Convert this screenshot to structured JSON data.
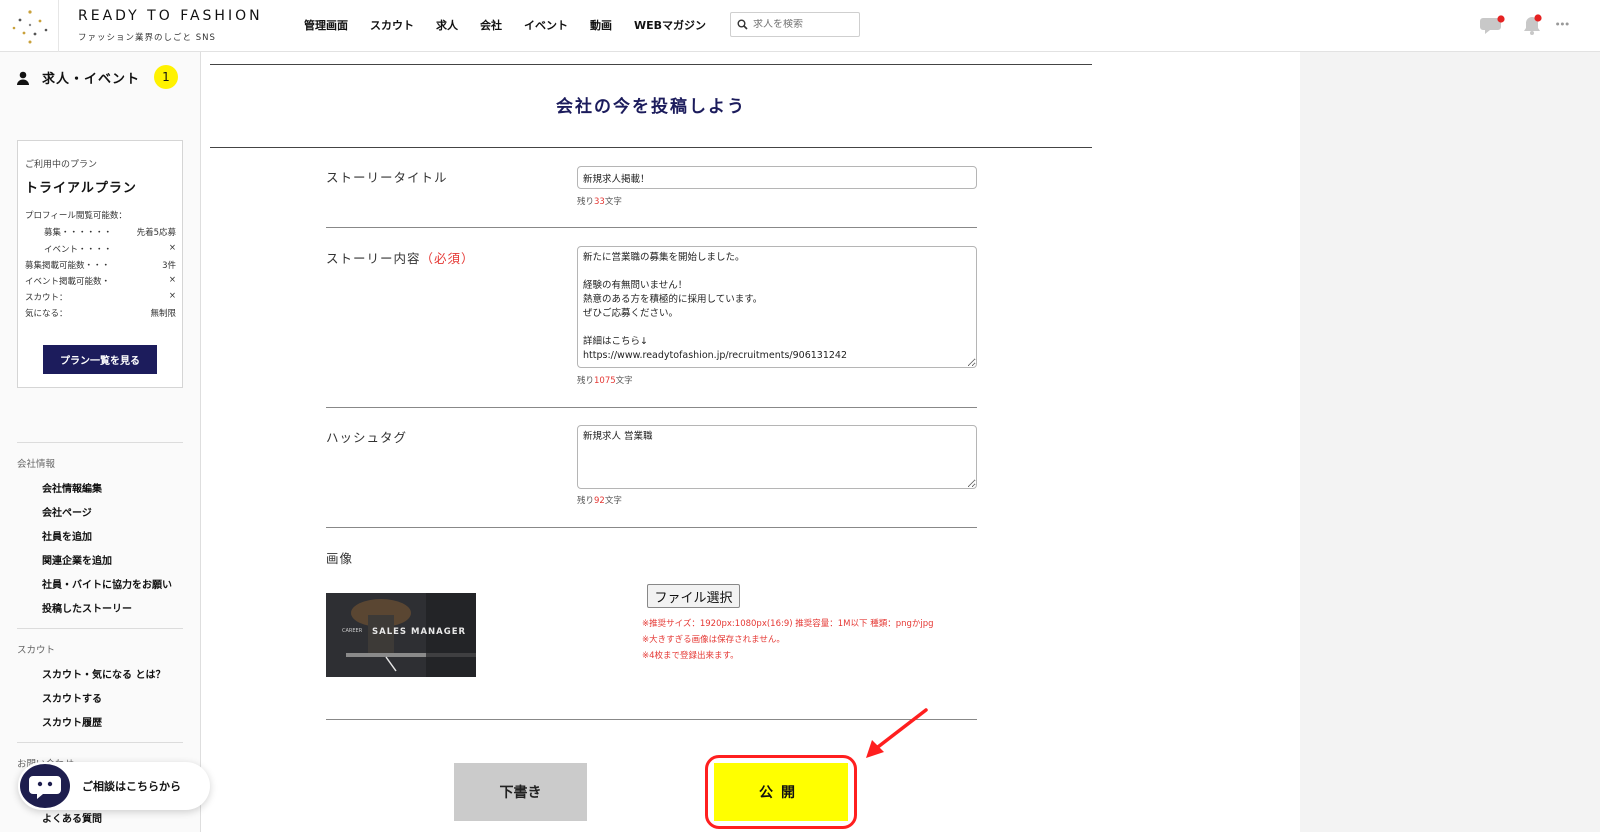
{
  "header": {
    "brand": "READY TO FASHION",
    "tagline": "ファッション業界のしごと SNS",
    "nav": [
      "管理画面",
      "スカウト",
      "求人",
      "会社",
      "イベント",
      "動画",
      "WEBマガジン"
    ],
    "search_placeholder": "求人を検索",
    "icons": [
      "chat-icon",
      "bell-icon"
    ],
    "accent_color": "#ff1f1f"
  },
  "sidebar": {
    "section_label": "求人・イベント",
    "badge_count": "1",
    "plan": {
      "caption": "ご利用中のプラン",
      "name": "トライアルプラン",
      "rows": [
        {
          "label": "プロフィール閲覧可能数：",
          "value": ""
        },
        {
          "label": "募集・・・・・・",
          "value": "先着5応募"
        },
        {
          "label": "イベント・・・・",
          "value": "×"
        },
        {
          "label": "募集掲載可能数・・・",
          "value": "3件"
        },
        {
          "label": "イベント掲載可能数・",
          "value": "×"
        },
        {
          "label": "スカウト：",
          "value": "×"
        },
        {
          "label": "気になる：",
          "value": "無制限"
        }
      ],
      "button": "プラン一覧を見る"
    },
    "groups": [
      {
        "title": "会社情報",
        "items": [
          "会社情報編集",
          "会社ページ",
          "社員を追加",
          "関連企業を追加",
          "社員・バイトに協力をお願い",
          "投稿したストーリー"
        ]
      },
      {
        "title": "スカウト",
        "items": [
          "スカウト・気になる とは？",
          "スカウトする",
          "スカウト履歴"
        ]
      },
      {
        "title": "お問い合わせ",
        "items": [
          "よくある質問"
        ]
      }
    ],
    "chat_label": "ご相談はこちらから"
  },
  "form": {
    "title": "会社の今を投稿しよう",
    "story_title": {
      "label": "ストーリータイトル",
      "value": "新規求人掲載！",
      "remain_prefix": "残り",
      "remain_num": "33",
      "remain_suffix": "文字"
    },
    "story_body": {
      "label": "ストーリー内容",
      "required": "（必須）",
      "value": "新たに営業職の募集を開始しました。\n\n経験の有無問いません！\n熱意のある方を積極的に採用しています。\nぜひご応募ください。\n\n詳細はこちら↓\nhttps://www.readytofashion.jp/recruitments/906131242",
      "remain_prefix": "残り",
      "remain_num": "1075",
      "remain_suffix": "文字"
    },
    "hashtag": {
      "label": "ハッシュタグ",
      "value": "新規求人 営業職",
      "remain_prefix": "残り",
      "remain_num": "92",
      "remain_suffix": "文字"
    },
    "image": {
      "label": "画像",
      "thumb_text": "SALES MANAGER",
      "file_button": "ファイル選択",
      "notes": [
        "※推奨サイズ：1920px:1080px(16:9) 推奨容量：1M以下 種類：pngかjpg",
        "※大きすぎる画像は保存されません。",
        "※4枚まで登録出来ます。"
      ]
    },
    "draft_button": "下書き",
    "publish_button": "公開"
  }
}
